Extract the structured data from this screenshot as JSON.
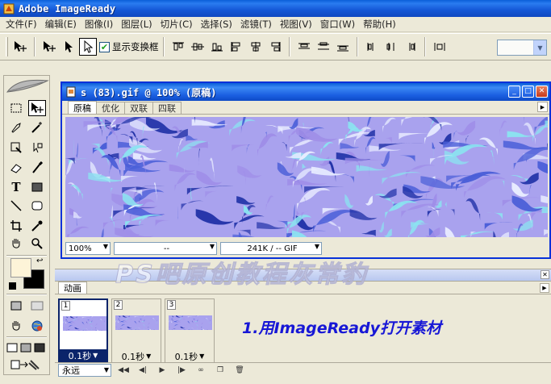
{
  "app": {
    "title": "Adobe ImageReady"
  },
  "menu": [
    "文件(F)",
    "编辑(E)",
    "图像(I)",
    "图层(L)",
    "切片(C)",
    "选择(S)",
    "滤镜(T)",
    "视图(V)",
    "窗口(W)",
    "帮助(H)"
  ],
  "options_bar": {
    "show_transform_label": "显示变换框",
    "show_transform_checked": true
  },
  "document": {
    "title": "s (83).gif @ 100% (原稿)",
    "tabs": [
      "原稿",
      "优化",
      "双联",
      "四联"
    ],
    "active_tab": "原稿",
    "zoom": "100%",
    "status_middle": "--",
    "status_info": "241K / -- GIF"
  },
  "watermark": "PS吧原创教程灰常豹",
  "animation": {
    "tab_label": "动画",
    "frames": [
      {
        "number": "1",
        "delay": "0.1秒",
        "selected": true
      },
      {
        "number": "2",
        "delay": "0.1秒",
        "selected": false
      },
      {
        "number": "3",
        "delay": "0.1秒",
        "selected": false
      }
    ],
    "loop": "永远",
    "note": "1.用ImageReady打开素材"
  },
  "icons": {
    "app_icon": "imageready-icon",
    "canvas_pattern_colors": [
      "#8be3f0",
      "#9f8ee8",
      "#4b5fd8",
      "#e8ecff",
      "#2233a8"
    ]
  }
}
